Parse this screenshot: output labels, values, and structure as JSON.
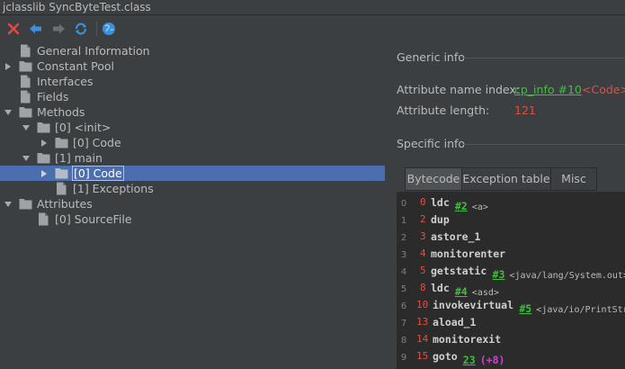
{
  "window": {
    "title": "jclasslib SyncByteTest.class"
  },
  "toolbar": {
    "icons": [
      "close-icon",
      "back-icon",
      "forward-icon",
      "reload-icon",
      "web-icon"
    ]
  },
  "tree": {
    "general_information": "General Information",
    "constant_pool": "Constant Pool",
    "interfaces": "Interfaces",
    "fields": "Fields",
    "methods": "Methods",
    "method_init": "[0] <init>",
    "init_code": "[0] Code",
    "method_main": "[1] main",
    "main_code": "[0] Code",
    "main_exceptions": "[1] Exceptions",
    "attributes": "Attributes",
    "source_file": "[0] SourceFile"
  },
  "generic_info": {
    "title": "Generic info",
    "name_index_label": "Attribute name index:",
    "name_index_link": "cp_info #10",
    "name_index_value": "<Code>",
    "length_label": "Attribute length:",
    "length_value": "121"
  },
  "specific_info": {
    "title": "Specific info",
    "tabs": [
      "Bytecode",
      "Exception table",
      "Misc"
    ],
    "active_tab": "Bytecode"
  },
  "bytecode": [
    {
      "line": "0",
      "offset": "0",
      "op": "ldc",
      "ref": "#2",
      "comment": "<a>"
    },
    {
      "line": "1",
      "offset": "2",
      "op": "dup"
    },
    {
      "line": "2",
      "offset": "3",
      "op": "astore_1"
    },
    {
      "line": "3",
      "offset": "4",
      "op": "monitorenter"
    },
    {
      "line": "4",
      "offset": "5",
      "op": "getstatic",
      "ref": "#3",
      "comment": "<java/lang/System.out>"
    },
    {
      "line": "5",
      "offset": "8",
      "op": "ldc",
      "ref": "#4",
      "comment": "<asd>"
    },
    {
      "line": "6",
      "offset": "10",
      "op": "invokevirtual",
      "ref": "#5",
      "comment": "<java/io/PrintStream.println>"
    },
    {
      "line": "7",
      "offset": "13",
      "op": "aload_1"
    },
    {
      "line": "8",
      "offset": "14",
      "op": "monitorexit"
    },
    {
      "line": "9",
      "offset": "15",
      "op": "goto",
      "ref": "23",
      "rel": "(+8)"
    }
  ],
  "colors": {
    "background": "#3c3f41",
    "selection": "#4b6eaf",
    "link": "#3fbf3f",
    "value": "#e0503d",
    "relative": "#cc44cc",
    "code_bg": "#2b2b2b"
  }
}
